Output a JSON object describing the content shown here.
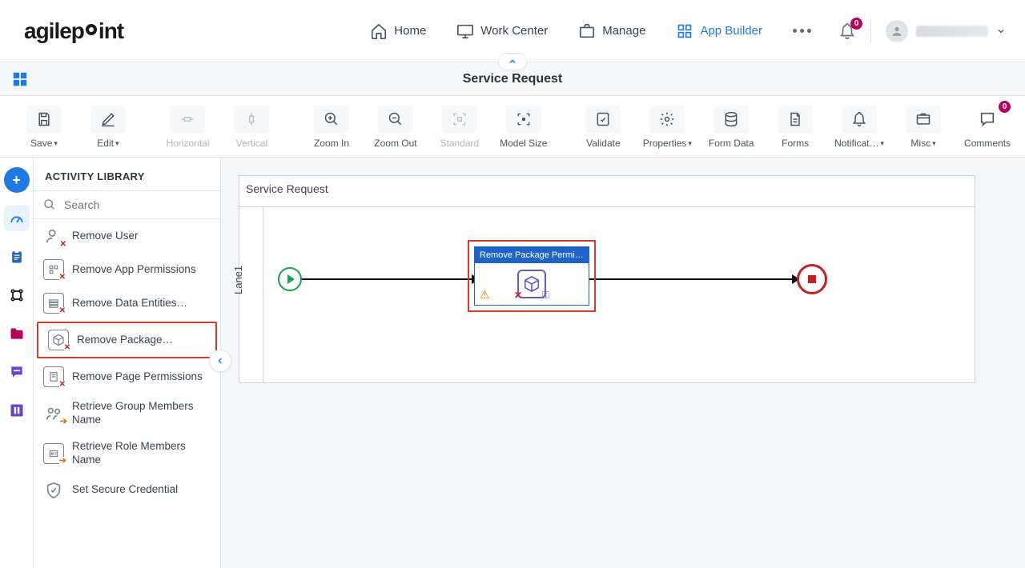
{
  "header": {
    "logo_text": "agilepoint",
    "nav": {
      "home": "Home",
      "work_center": "Work Center",
      "manage": "Manage",
      "app_builder": "App Builder"
    },
    "notifications_badge": "0",
    "user_name": "(user)"
  },
  "subheader": {
    "title": "Service Request"
  },
  "toolbar": {
    "save": "Save",
    "edit": "Edit",
    "horizontal": "Horizontal",
    "vertical": "Vertical",
    "zoom_in": "Zoom In",
    "zoom_out": "Zoom Out",
    "standard": "Standard",
    "model_size": "Model Size",
    "validate": "Validate",
    "properties": "Properties",
    "form_data": "Form Data",
    "forms": "Forms",
    "notifications": "Notificat…",
    "misc": "Misc",
    "comments": "Comments",
    "comments_badge": "0"
  },
  "library": {
    "title": "ACTIVITY LIBRARY",
    "search_placeholder": "Search",
    "items": {
      "remove_user": "Remove User",
      "remove_app_permissions": "Remove App Permissions",
      "remove_data_entities": "Remove Data Entities…",
      "remove_package": "Remove Package…",
      "remove_page_permissions": "Remove Page Permissions",
      "retrieve_group_members": "Retrieve Group Members Name",
      "retrieve_role_members": "Retrieve Role Members Name",
      "set_secure_credential": "Set Secure Credential"
    }
  },
  "canvas": {
    "title": "Service Request",
    "lane_label": "Lane1",
    "activity_label": "Remove Package Permi…"
  }
}
